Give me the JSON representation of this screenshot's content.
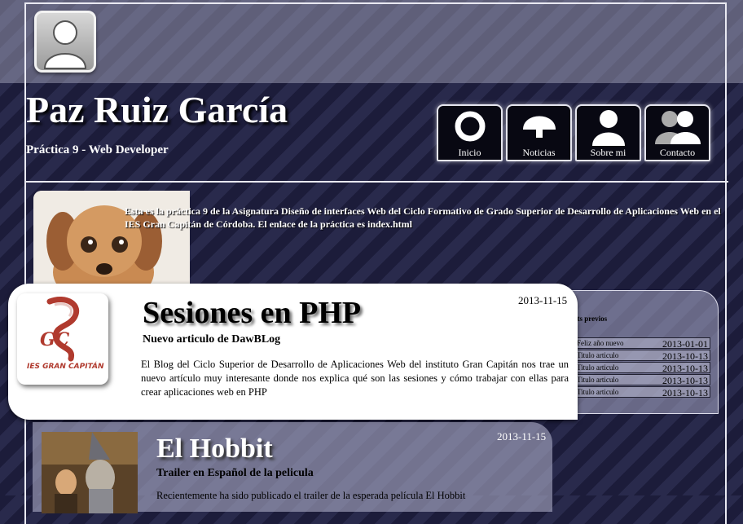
{
  "header": {
    "name": "Paz Ruiz García",
    "subtitle": "Práctica 9 - Web Developer"
  },
  "nav": {
    "items": [
      {
        "label": "Inicio",
        "icon": "ring-icon"
      },
      {
        "label": "Noticias",
        "icon": "dome-icon"
      },
      {
        "label": "Sobre mi",
        "icon": "user-icon"
      },
      {
        "label": "Contacto",
        "icon": "users-icon"
      }
    ]
  },
  "intro": {
    "text": "Esta es la práctica 9 de la Asignatura Diseño de interfaces Web del Ciclo Formativo de Grado Superior de Desarrollo de Aplicaciones Web en el IES Gran Capitán de Córdoba. El enlace de la práctica es index.html"
  },
  "sidebar": {
    "title": "sts previos",
    "posts": [
      {
        "title": "Feliz año nuevo",
        "date": "2013-01-01"
      },
      {
        "title": "Titulo articulo",
        "date": "2013-10-13"
      },
      {
        "title": "Titulo articulo",
        "date": "2013-10-13"
      },
      {
        "title": "Titulo articulo",
        "date": "2013-10-13"
      },
      {
        "title": "Titulo articulo",
        "date": "2013-10-13"
      }
    ]
  },
  "articles": [
    {
      "date": "2013-11-15",
      "title": "Sesiones en PHP",
      "subtitle": "Nuevo articulo de DawBLog",
      "body": "El Blog del Ciclo Superior de Desarrollo de Aplicaciones Web del instituto Gran Capitán nos trae un nuevo artículo muy interesante donde nos explica qué son las sesiones y cómo trabajar con ellas para crear aplicaciones web en PHP",
      "logo_text": "IES GRAN CAPITÁN",
      "logo_initials": "GC"
    },
    {
      "date": "2013-11-15",
      "title": "El Hobbit",
      "subtitle": "Trailer en Español de la pelicula",
      "body": "Recientemente ha sido publicado el trailer de la esperada película El Hobbit"
    }
  ],
  "colors": {
    "background": "#1c1c3a",
    "stripe": "#292a4c",
    "panel": "#a8a8c4",
    "card": "#ffffff",
    "logo_red": "#b03a2e"
  }
}
